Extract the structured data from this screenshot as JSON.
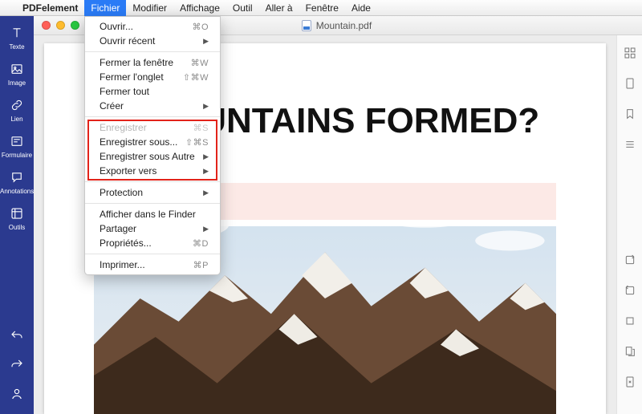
{
  "menubar": {
    "app_name": "PDFelement",
    "items": [
      {
        "label": "Fichier",
        "active": true
      },
      {
        "label": "Modifier"
      },
      {
        "label": "Affichage"
      },
      {
        "label": "Outil"
      },
      {
        "label": "Aller à"
      },
      {
        "label": "Fenêtre"
      },
      {
        "label": "Aide"
      }
    ]
  },
  "window": {
    "document_name": "Mountain.pdf"
  },
  "sidebar": {
    "items": [
      {
        "id": "text",
        "label": "Texte"
      },
      {
        "id": "image",
        "label": "Image"
      },
      {
        "id": "link",
        "label": "Lien"
      },
      {
        "id": "form",
        "label": "Formulaire"
      },
      {
        "id": "annot",
        "label": "Annotations"
      },
      {
        "id": "tools",
        "label": "Outils"
      }
    ]
  },
  "dropdown": {
    "groups": [
      [
        {
          "label": "Ouvrir...",
          "shortcut": "⌘O"
        },
        {
          "label": "Ouvrir récent",
          "submenu": true
        }
      ],
      [
        {
          "label": "Fermer la fenêtre",
          "shortcut": "⌘W"
        },
        {
          "label": "Fermer l'onglet",
          "shortcut": "⇧⌘W"
        },
        {
          "label": "Fermer tout"
        },
        {
          "label": "Créer",
          "submenu": true
        }
      ],
      [
        {
          "label": "Enregistrer",
          "shortcut": "⌘S",
          "disabled": true
        },
        {
          "label": "Enregistrer sous...",
          "shortcut": "⇧⌘S"
        },
        {
          "label": "Enregistrer sous Autre",
          "submenu": true
        },
        {
          "label": "Exporter vers",
          "submenu": true
        }
      ],
      [
        {
          "label": "Protection",
          "submenu": true
        }
      ],
      [
        {
          "label": "Afficher dans le Finder"
        },
        {
          "label": "Partager",
          "submenu": true
        },
        {
          "label": "Propriétés...",
          "shortcut": "⌘D"
        }
      ],
      [
        {
          "label": "Imprimer...",
          "shortcut": "⌘P"
        }
      ]
    ],
    "highlight_group_index": 2
  },
  "document": {
    "headline_visible": "E MOUNTAINS FORMED?",
    "headline_full": "HOW ARE MOUNTAINS FORMED?"
  }
}
